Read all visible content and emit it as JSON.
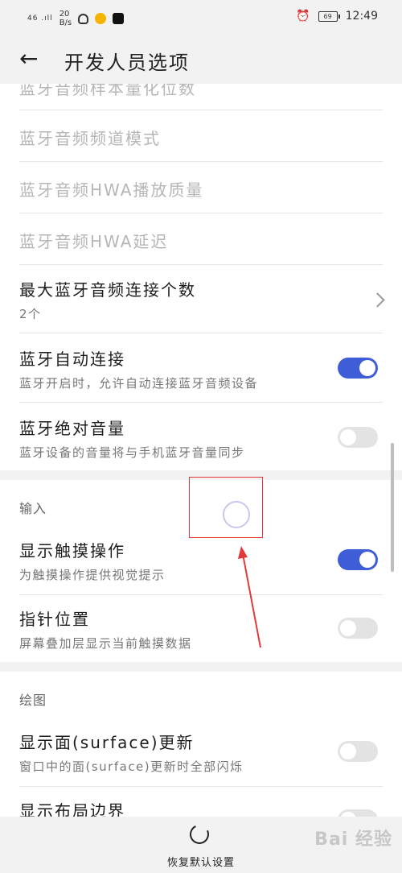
{
  "status": {
    "signal": "46 .ıll",
    "speed_value": "20",
    "speed_unit": "B/s",
    "battery": "69",
    "time": "12:49"
  },
  "header": {
    "title": "开发人员选项"
  },
  "items": {
    "partial": "蓝牙音频样本量化位数",
    "channel_mode": "蓝牙音频频道模式",
    "hwa_quality": "蓝牙音频HWA播放质量",
    "hwa_latency": "蓝牙音频HWA延迟",
    "max_connections": {
      "title": "最大蓝牙音频连接个数",
      "value": "2个"
    },
    "auto_connect": {
      "title": "蓝牙自动连接",
      "subtitle": "蓝牙开启时，允许自动连接蓝牙音频设备",
      "enabled": true
    },
    "absolute_volume": {
      "title": "蓝牙绝对音量",
      "subtitle": "蓝牙设备的音量将与手机蓝牙音量同步",
      "enabled": false
    }
  },
  "input_section": {
    "header": "输入",
    "show_taps": {
      "title": "显示触摸操作",
      "subtitle": "为触摸操作提供视觉提示",
      "enabled": true
    },
    "pointer_location": {
      "title": "指针位置",
      "subtitle": "屏幕叠加层显示当前触摸数据",
      "enabled": false
    }
  },
  "drawing_section": {
    "header": "绘图",
    "surface_updates": {
      "title": "显示面(surface)更新",
      "subtitle": "窗口中的面(surface)更新时全部闪烁",
      "enabled": false
    },
    "layout_bounds": {
      "title": "显示布局边界",
      "enabled": false
    }
  },
  "footer": {
    "reset_label": "恢复默认设置"
  },
  "watermark": "Bai 经验",
  "colors": {
    "accent": "#3f5dd6",
    "annotation": "#e13a3a"
  }
}
